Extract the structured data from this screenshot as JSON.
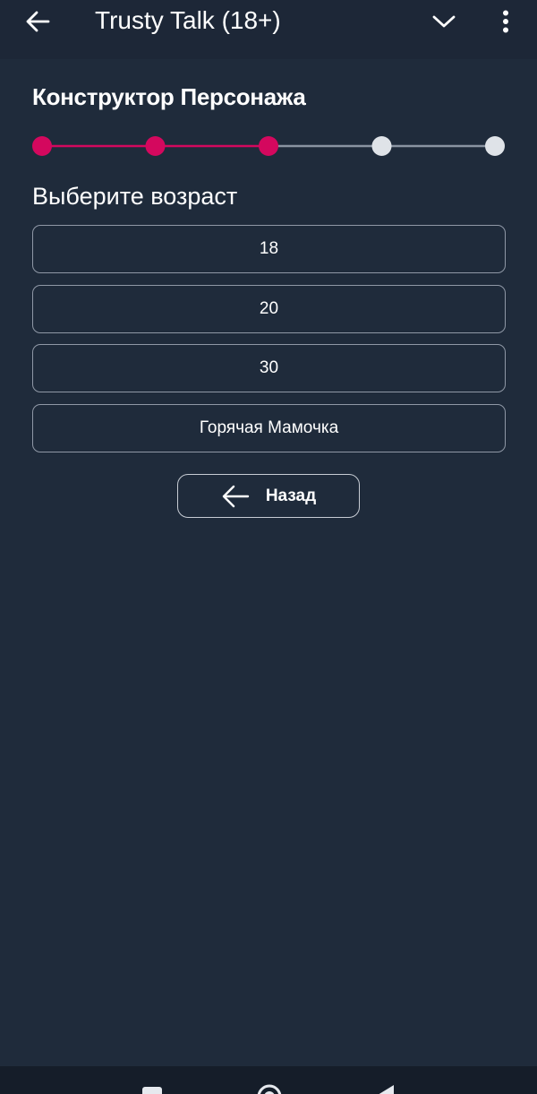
{
  "app_bar": {
    "title": "Trusty Talk (18+)",
    "icons": [
      "back-arrow-icon",
      "chevron-down-icon",
      "more-vertical-icon"
    ]
  },
  "heading": "Конструктор Персонажа",
  "stepper": {
    "total_steps": 5,
    "completed_steps": 3,
    "active_color": "#d4085e",
    "inactive_color": "#dfe3e8"
  },
  "subtitle": "Выберите возраст",
  "options": [
    {
      "label": "18"
    },
    {
      "label": "20"
    },
    {
      "label": "30"
    },
    {
      "label": "Горячая Мамочка"
    }
  ],
  "back_button": {
    "label": "Назад",
    "icon": "arrow-left-icon"
  },
  "system_nav": {
    "icons": [
      "recents-square-icon",
      "home-circle-icon",
      "back-triangle-icon"
    ]
  },
  "colors": {
    "background": "#1f2b3b",
    "app_bar": "#1d2737",
    "accent": "#d4085e"
  }
}
